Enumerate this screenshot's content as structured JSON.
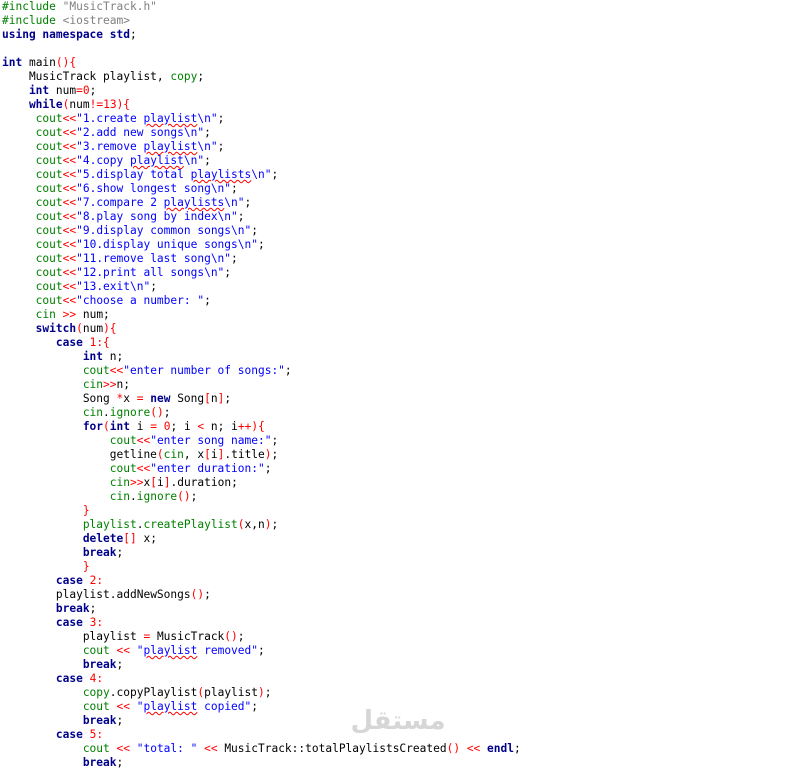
{
  "editor": {
    "lines": [
      [
        [
          "pp",
          "#include "
        ],
        [
          "ppstr",
          "\"MusicTrack.h\""
        ]
      ],
      [
        [
          "pp",
          "#include "
        ],
        [
          "ppstr",
          "<iostream>"
        ]
      ],
      [
        [
          "kw",
          "using namespace "
        ],
        [
          "kwn",
          "std"
        ],
        [
          "",
          "; "
        ]
      ],
      [
        [
          "",
          ""
        ]
      ],
      [
        [
          "kw",
          "int "
        ],
        [
          "",
          "main"
        ],
        [
          "br",
          "()"
        ],
        [
          "br",
          "{"
        ]
      ],
      [
        [
          "",
          "    MusicTrack playlist, "
        ],
        [
          "io",
          "copy"
        ],
        [
          "",
          ";"
        ]
      ],
      [
        [
          "kw",
          "    int "
        ],
        [
          "",
          "num"
        ],
        [
          "op",
          "="
        ],
        [
          "num",
          "0"
        ],
        [
          "",
          ";"
        ]
      ],
      [
        [
          "kw",
          "    while"
        ],
        [
          "br",
          "("
        ],
        [
          "",
          "num"
        ],
        [
          "op",
          "!="
        ],
        [
          "num",
          "13"
        ],
        [
          "br",
          "){"
        ]
      ],
      [
        [
          "io",
          "     cout"
        ],
        [
          "op",
          "<<"
        ],
        [
          "str",
          "\"1.create "
        ],
        [
          "strt",
          "playlist"
        ],
        [
          "str",
          "\\n\""
        ],
        [
          "",
          ";"
        ]
      ],
      [
        [
          "io",
          "     cout"
        ],
        [
          "op",
          "<<"
        ],
        [
          "str",
          "\"2.add new songs\\n\""
        ],
        [
          "",
          ";"
        ]
      ],
      [
        [
          "io",
          "     cout"
        ],
        [
          "op",
          "<<"
        ],
        [
          "str",
          "\"3.remove "
        ],
        [
          "strt",
          "playlist"
        ],
        [
          "str",
          "\\n\""
        ],
        [
          "",
          ";"
        ]
      ],
      [
        [
          "io",
          "     cout"
        ],
        [
          "op",
          "<<"
        ],
        [
          "str",
          "\"4.copy "
        ],
        [
          "strt",
          "playlist"
        ],
        [
          "str",
          "\\n\""
        ],
        [
          "",
          ";"
        ]
      ],
      [
        [
          "io",
          "     cout"
        ],
        [
          "op",
          "<<"
        ],
        [
          "str",
          "\"5.display total "
        ],
        [
          "strt",
          "playlists"
        ],
        [
          "str",
          "\\n\""
        ],
        [
          "",
          ";"
        ]
      ],
      [
        [
          "io",
          "     cout"
        ],
        [
          "op",
          "<<"
        ],
        [
          "str",
          "\"6.show longest song\\n\""
        ],
        [
          "",
          ";"
        ]
      ],
      [
        [
          "io",
          "     cout"
        ],
        [
          "op",
          "<<"
        ],
        [
          "str",
          "\"7.compare 2 "
        ],
        [
          "strt",
          "playlists"
        ],
        [
          "str",
          "\\n\""
        ],
        [
          "",
          ";"
        ]
      ],
      [
        [
          "io",
          "     cout"
        ],
        [
          "op",
          "<<"
        ],
        [
          "str",
          "\"8.play song by index\\n\""
        ],
        [
          "",
          ";"
        ]
      ],
      [
        [
          "io",
          "     cout"
        ],
        [
          "op",
          "<<"
        ],
        [
          "str",
          "\"9.display common songs\\n\""
        ],
        [
          "",
          ";"
        ]
      ],
      [
        [
          "io",
          "     cout"
        ],
        [
          "op",
          "<<"
        ],
        [
          "str",
          "\"10.display unique songs\\n\""
        ],
        [
          "",
          ";"
        ]
      ],
      [
        [
          "io",
          "     cout"
        ],
        [
          "op",
          "<<"
        ],
        [
          "str",
          "\"11.remove last song\\n\""
        ],
        [
          "",
          ";"
        ]
      ],
      [
        [
          "io",
          "     cout"
        ],
        [
          "op",
          "<<"
        ],
        [
          "str",
          "\"12.print all songs\\n\""
        ],
        [
          "",
          ";"
        ]
      ],
      [
        [
          "io",
          "     cout"
        ],
        [
          "op",
          "<<"
        ],
        [
          "str",
          "\"13.exit\\n\""
        ],
        [
          "",
          ";"
        ]
      ],
      [
        [
          "io",
          "     cout"
        ],
        [
          "op",
          "<<"
        ],
        [
          "str",
          "\"choose a number: \""
        ],
        [
          "",
          ";"
        ]
      ],
      [
        [
          "io",
          "     cin "
        ],
        [
          "op",
          ">>"
        ],
        [
          "",
          " num;"
        ]
      ],
      [
        [
          "kw",
          "     switch"
        ],
        [
          "br",
          "("
        ],
        [
          "",
          "num"
        ],
        [
          "br",
          "){"
        ]
      ],
      [
        [
          "kw",
          "        case "
        ],
        [
          "num",
          "1"
        ],
        [
          "br",
          ":{"
        ]
      ],
      [
        [
          "kw",
          "            int "
        ],
        [
          "",
          "n;"
        ]
      ],
      [
        [
          "io",
          "            cout"
        ],
        [
          "op",
          "<<"
        ],
        [
          "str",
          "\"enter number of songs:\""
        ],
        [
          "",
          ";"
        ]
      ],
      [
        [
          "io",
          "            cin"
        ],
        [
          "op",
          ">>"
        ],
        [
          "",
          "n;"
        ]
      ],
      [
        [
          "",
          "            Song "
        ],
        [
          "op",
          "*"
        ],
        [
          "",
          "x "
        ],
        [
          "op",
          "="
        ],
        [
          "kw",
          " new "
        ],
        [
          "",
          "Song"
        ],
        [
          "br",
          "["
        ],
        [
          "",
          "n"
        ],
        [
          "br",
          "]"
        ],
        [
          "",
          ";"
        ]
      ],
      [
        [
          "io",
          "            cin"
        ],
        [
          "",
          "."
        ],
        [
          "io",
          "ignore"
        ],
        [
          "br",
          "()"
        ],
        [
          "",
          ";"
        ]
      ],
      [
        [
          "kw",
          "            for"
        ],
        [
          "br",
          "("
        ],
        [
          "kw",
          "int "
        ],
        [
          "",
          "i "
        ],
        [
          "op",
          "="
        ],
        [
          "num",
          " 0"
        ],
        [
          "",
          "; i "
        ],
        [
          "op",
          "<"
        ],
        [
          "",
          " n; i"
        ],
        [
          "op",
          "++"
        ],
        [
          "br",
          "){"
        ]
      ],
      [
        [
          "io",
          "                cout"
        ],
        [
          "op",
          "<<"
        ],
        [
          "str",
          "\"enter song name:\""
        ],
        [
          "",
          ";"
        ]
      ],
      [
        [
          "",
          "                getline"
        ],
        [
          "br",
          "("
        ],
        [
          "io",
          "cin"
        ],
        [
          "",
          ", x"
        ],
        [
          "br",
          "["
        ],
        [
          "",
          "i"
        ],
        [
          "br",
          "]"
        ],
        [
          "",
          ".title"
        ],
        [
          "br",
          ")"
        ],
        [
          "",
          ";"
        ]
      ],
      [
        [
          "io",
          "                cout"
        ],
        [
          "op",
          "<<"
        ],
        [
          "str",
          "\"enter duration:\""
        ],
        [
          "",
          ";"
        ]
      ],
      [
        [
          "io",
          "                cin"
        ],
        [
          "op",
          ">>"
        ],
        [
          "",
          "x"
        ],
        [
          "br",
          "["
        ],
        [
          "",
          "i"
        ],
        [
          "br",
          "]"
        ],
        [
          "",
          ".duration;"
        ]
      ],
      [
        [
          "io",
          "                cin"
        ],
        [
          "",
          "."
        ],
        [
          "io",
          "ignore"
        ],
        [
          "br",
          "()"
        ],
        [
          "",
          ";"
        ]
      ],
      [
        [
          "br",
          "            }"
        ]
      ],
      [
        [
          "io",
          "            playlist"
        ],
        [
          "",
          "."
        ],
        [
          "io",
          "createPlaylist"
        ],
        [
          "br",
          "("
        ],
        [
          "",
          "x,n"
        ],
        [
          "br",
          ")"
        ],
        [
          "",
          ";"
        ]
      ],
      [
        [
          "kw",
          "            delete"
        ],
        [
          "br",
          "[]"
        ],
        [
          "",
          " x;"
        ]
      ],
      [
        [
          "kw",
          "            break"
        ],
        [
          "",
          ";"
        ]
      ],
      [
        [
          "br",
          "            }"
        ]
      ],
      [
        [
          "kw",
          "        case "
        ],
        [
          "num",
          "2"
        ],
        [
          "br",
          ":"
        ]
      ],
      [
        [
          "",
          "        playlist."
        ],
        [
          "",
          "addNewSongs"
        ],
        [
          "br",
          "()"
        ],
        [
          "",
          ";"
        ]
      ],
      [
        [
          "kw",
          "        break"
        ],
        [
          "",
          ";"
        ]
      ],
      [
        [
          "kw",
          "        case "
        ],
        [
          "num",
          "3"
        ],
        [
          "br",
          ":"
        ]
      ],
      [
        [
          "",
          "            playlist "
        ],
        [
          "op",
          "="
        ],
        [
          "",
          " MusicTrack"
        ],
        [
          "br",
          "()"
        ],
        [
          "",
          ";"
        ]
      ],
      [
        [
          "io",
          "            cout "
        ],
        [
          "op",
          "<<"
        ],
        [
          "str",
          " \""
        ],
        [
          "strt",
          "playlist"
        ],
        [
          "str",
          " removed\""
        ],
        [
          "",
          ";"
        ]
      ],
      [
        [
          "kw",
          "            break"
        ],
        [
          "",
          ";"
        ]
      ],
      [
        [
          "kw",
          "        case "
        ],
        [
          "num",
          "4"
        ],
        [
          "br",
          ":"
        ]
      ],
      [
        [
          "io",
          "            copy"
        ],
        [
          "",
          "."
        ],
        [
          "",
          "copyPlaylist"
        ],
        [
          "br",
          "("
        ],
        [
          "",
          "playlist"
        ],
        [
          "br",
          ")"
        ],
        [
          "",
          ";"
        ]
      ],
      [
        [
          "io",
          "            cout "
        ],
        [
          "op",
          "<<"
        ],
        [
          "str",
          " \""
        ],
        [
          "strt",
          "playlist"
        ],
        [
          "str",
          " copied\""
        ],
        [
          "",
          ";"
        ]
      ],
      [
        [
          "kw",
          "            break"
        ],
        [
          "",
          ";"
        ]
      ],
      [
        [
          "kw",
          "        case "
        ],
        [
          "num",
          "5"
        ],
        [
          "br",
          ":"
        ]
      ],
      [
        [
          "io",
          "            cout "
        ],
        [
          "op",
          "<<"
        ],
        [
          "str",
          " \"total: \" "
        ],
        [
          "op",
          "<<"
        ],
        [
          "",
          " MusicTrack::totalPlaylistsCreated"
        ],
        [
          "br",
          "()"
        ],
        [
          "op",
          " <<"
        ],
        [
          "kw",
          " endl"
        ],
        [
          "",
          ";"
        ]
      ],
      [
        [
          "kw",
          "            break"
        ],
        [
          "",
          ";"
        ]
      ]
    ]
  },
  "watermark": {
    "text": "مستقل"
  }
}
